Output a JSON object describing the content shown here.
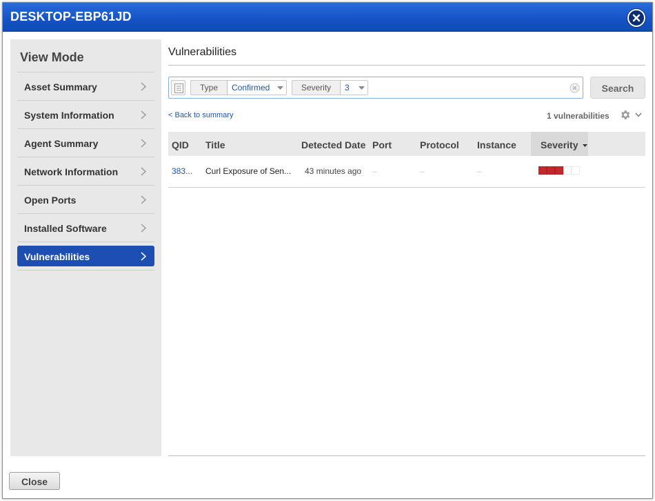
{
  "window": {
    "title": "DESKTOP-EBP61JD"
  },
  "sidebar": {
    "heading": "View Mode",
    "items": [
      {
        "label": "Asset Summary"
      },
      {
        "label": "System Information"
      },
      {
        "label": "Agent Summary"
      },
      {
        "label": "Network Information"
      },
      {
        "label": "Open Ports"
      },
      {
        "label": "Installed Software"
      },
      {
        "label": "Vulnerabilities",
        "active": true
      }
    ]
  },
  "main": {
    "title": "Vulnerabilities",
    "filters": [
      {
        "key": "Type",
        "value": "Confirmed"
      },
      {
        "key": "Severity",
        "value": "3"
      }
    ],
    "search_label": "Search",
    "back_link": "< Back to summary",
    "result_count": "1 vulnerabilities",
    "columns": [
      "QID",
      "Title",
      "Detected Date",
      "Port",
      "Protocol",
      "Instance",
      "Severity"
    ],
    "sorted_column": "Severity",
    "rows": [
      {
        "qid": "383...",
        "title": "Curl Exposure of Sen...",
        "detected": "43 minutes ago",
        "port": "–",
        "protocol": "–",
        "instance": "–",
        "severity_level": 3,
        "severity_max": 5
      }
    ]
  },
  "footer": {
    "close_label": "Close"
  },
  "colors": {
    "titlebar": "#1453c5",
    "active_nav": "#1d4fb2",
    "link": "#1a56a8",
    "severity_fill": "#c0292e"
  },
  "icons": {
    "window_close": "close-x-icon",
    "nav_chevron": "chevron-right-icon",
    "filter_list": "list-icon",
    "clear": "clear-circle-icon",
    "settings": "gear-icon"
  }
}
